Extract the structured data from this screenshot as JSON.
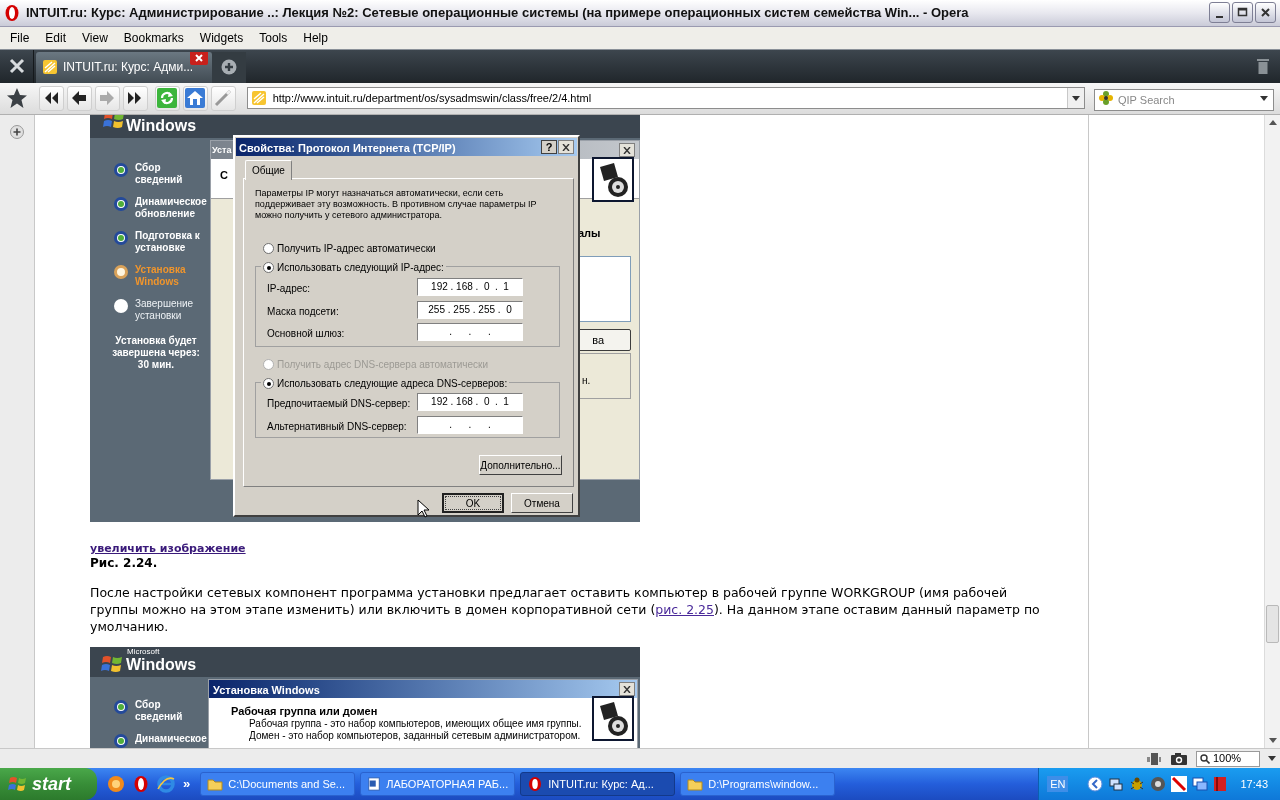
{
  "window": {
    "title": "INTUIT.ru: Курс: Администрирование ..: Лекция №2: Сетевые операционные системы (на примере операционных систем семейства Win... - Opera"
  },
  "menu": [
    "File",
    "Edit",
    "View",
    "Bookmarks",
    "Widgets",
    "Tools",
    "Help"
  ],
  "tabs": [
    {
      "label": "INTUIT.ru: Курс: Адми...",
      "selected": true
    }
  ],
  "address": "http://www.intuit.ru/department/os/sysadmswin/class/free/2/4.html",
  "search": {
    "placeholder": "QIP Search"
  },
  "figure_1": {
    "logo": "Windows",
    "steps": [
      {
        "label": "Сбор сведений",
        "kind": "done"
      },
      {
        "label": "Динамическое обновление",
        "kind": "done"
      },
      {
        "label": "Подготовка к установке",
        "kind": "done"
      },
      {
        "label": "Установка Windows",
        "kind": "current"
      },
      {
        "label": "Завершение установки",
        "kind": "pending"
      }
    ],
    "time_left": "Установка будет завершена через: 30 мин.",
    "background_window": {
      "title": "Уста",
      "heading": "С",
      "section": "алы",
      "button": "ва",
      "note": "н."
    },
    "dialog": {
      "title": "Свойства: Протокол Интернета (TCP/IP)",
      "help_button": "?",
      "tabs": [
        {
          "label": "Общие",
          "selected": true
        }
      ],
      "description": "Параметры IP могут назначаться автоматически, если сеть поддерживает эту возможность. В противном случае параметры IP можно получить у сетевого администратора.",
      "ip_options": [
        {
          "label": "Получить IP-адрес автоматически",
          "selected": false,
          "disabled": false
        },
        {
          "label": "Использовать следующий IP-адрес:",
          "selected": true,
          "disabled": false
        }
      ],
      "ip_fields": [
        {
          "label": "IP-адрес:",
          "value": "192 . 168 .  0  .  1"
        },
        {
          "label": "Маска подсети:",
          "value": "255 . 255 . 255 .  0"
        },
        {
          "label": "Основной шлюз:",
          "value": ".      .      ."
        }
      ],
      "dns_options": [
        {
          "label": "Получить адрес DNS-сервера автоматически",
          "selected": false,
          "disabled": true
        },
        {
          "label": "Использовать следующие адреса DNS-серверов:",
          "selected": true,
          "disabled": false
        }
      ],
      "dns_fields": [
        {
          "label": "Предпочитаемый DNS-сервер:",
          "value": "192 . 168 .  0  .  1"
        },
        {
          "label": "Альтернативный DNS-сервер:",
          "value": ".      .      ."
        }
      ],
      "advanced_button": "Дополнительно...",
      "buttons": [
        {
          "label": "OK",
          "default": true
        },
        {
          "label": "Отмена",
          "default": false
        }
      ]
    }
  },
  "enlarge_link": "увеличить изображение",
  "caption": "Рис. 2.24.",
  "paragraph": {
    "before": "После настройки сетевых компонент программа установки предлагает оставить компьютер в рабочей группе WORKGROUP (имя рабочей группы можно на этом этапе изменить) или включить в домен корпоративной сети (",
    "link": "рис. 2.25",
    "after": "). На данном этапе оставим данный параметр по умолчанию."
  },
  "figure_2": {
    "microsoft": "Microsoft",
    "logo": "Windows",
    "steps": [
      {
        "label": "Сбор сведений",
        "kind": "done"
      },
      {
        "label": "Динамическое",
        "kind": "done"
      }
    ],
    "window": {
      "title": "Установка Windows",
      "heading": "Рабочая группа или домен",
      "lines": [
        "Рабочая группа - это набор компьютеров, имеющих общее имя группы.",
        "Домен - это набор компьютеров, заданный сетевым администратором."
      ]
    }
  },
  "status_bar": {
    "zoom": "100%"
  },
  "taskbar": {
    "start": "start",
    "more": "»",
    "tasks": [
      {
        "label": "C:\\Documents and Se...",
        "kind": "folder",
        "selected": false
      },
      {
        "label": "ЛАБОРАТОРНАЯ РАБ...",
        "kind": "document",
        "selected": false
      },
      {
        "label": "INTUIT.ru: Курс: Ад...",
        "kind": "browser",
        "selected": true
      },
      {
        "label": "D:\\Programs\\window...",
        "kind": "folder",
        "selected": false
      }
    ],
    "language": "EN",
    "clock": "17:43"
  }
}
